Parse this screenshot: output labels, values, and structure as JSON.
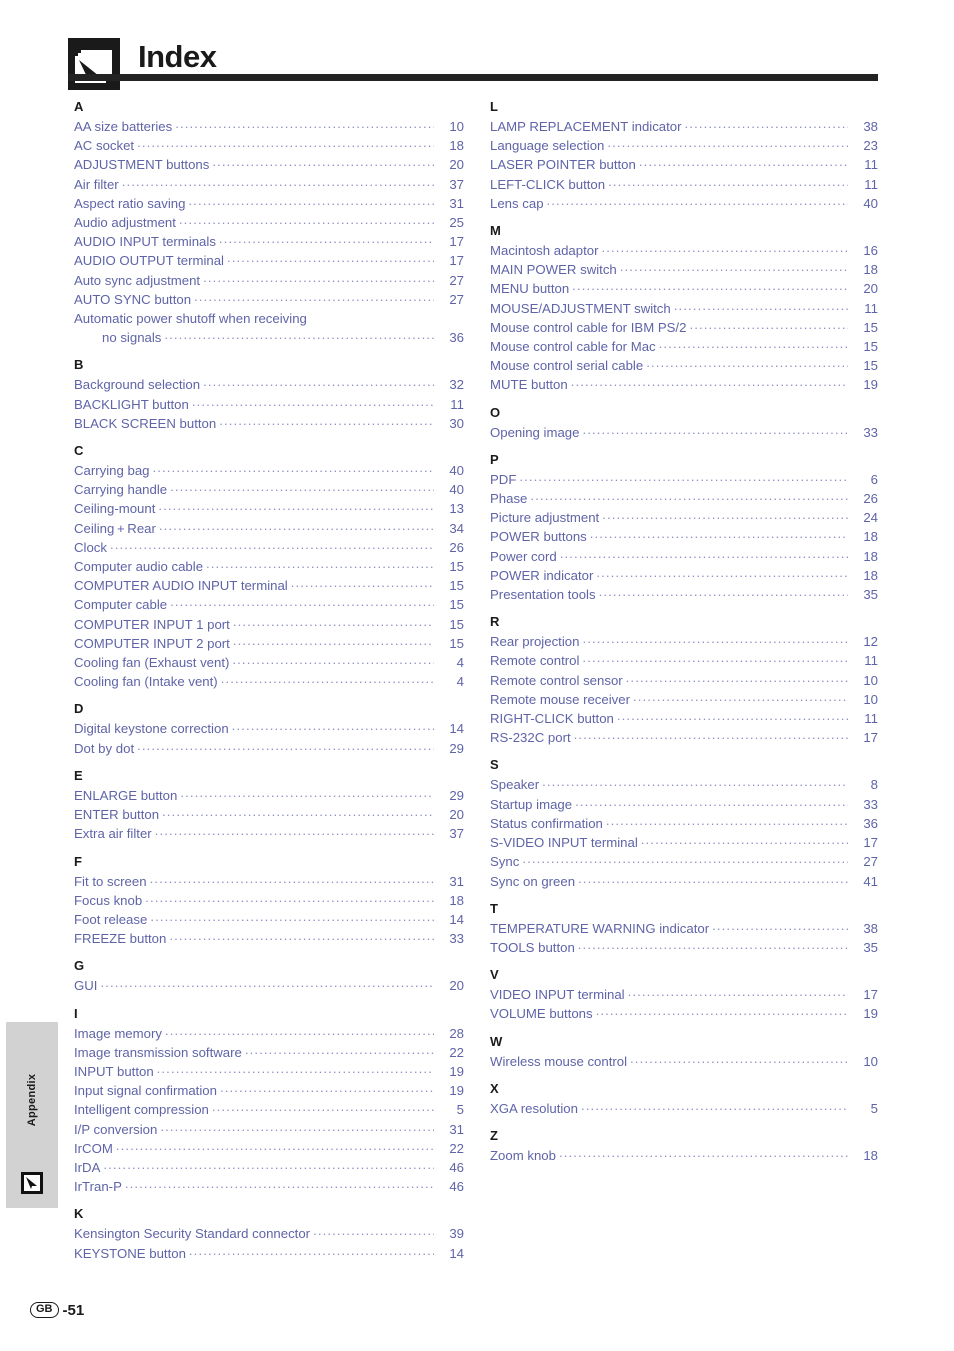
{
  "header": {
    "title": "Index",
    "icon": "index-cursor-pages-icon"
  },
  "sidebar_tab": {
    "label": "Appendix",
    "icon": "cursor-arrow-icon"
  },
  "footer": {
    "region_badge": "GB",
    "page_number": "-51"
  },
  "colors": {
    "entry_text": "#5f64a8",
    "heading_text": "#1a1a1a",
    "rule": "#232323",
    "tab_background": "#d2d2d2"
  },
  "columns": [
    {
      "groups": [
        {
          "letter": "A",
          "entries": [
            {
              "label": "AA size batteries",
              "page": "10"
            },
            {
              "label": "AC socket",
              "page": "18"
            },
            {
              "label": "ADJUSTMENT buttons",
              "page": "20"
            },
            {
              "label": "Air filter",
              "page": "37"
            },
            {
              "label": "Aspect ratio saving",
              "page": "31"
            },
            {
              "label": "Audio adjustment",
              "page": "25"
            },
            {
              "label": "AUDIO INPUT terminals",
              "page": "17"
            },
            {
              "label": "AUDIO OUTPUT terminal",
              "page": "17"
            },
            {
              "label": "Auto sync adjustment",
              "page": "27"
            },
            {
              "label": "AUTO SYNC button",
              "page": "27"
            },
            {
              "label": "Automatic power shutoff when receiving",
              "page": "",
              "dots": false
            },
            {
              "label": "no signals",
              "page": "36",
              "indent": true
            }
          ]
        },
        {
          "letter": "B",
          "entries": [
            {
              "label": "Background selection",
              "page": "32"
            },
            {
              "label": "BACKLIGHT button",
              "page": "11"
            },
            {
              "label": "BLACK SCREEN button",
              "page": "30"
            }
          ]
        },
        {
          "letter": "C",
          "entries": [
            {
              "label": "Carrying bag",
              "page": "40"
            },
            {
              "label": "Carrying handle",
              "page": "40"
            },
            {
              "label": "Ceiling-mount",
              "page": "13"
            },
            {
              "label": "Ceiling + Rear",
              "page": "34"
            },
            {
              "label": "Clock",
              "page": "26"
            },
            {
              "label": "Computer audio cable",
              "page": "15"
            },
            {
              "label": "COMPUTER AUDIO INPUT terminal",
              "page": "15"
            },
            {
              "label": "Computer cable",
              "page": "15"
            },
            {
              "label": "COMPUTER INPUT 1 port",
              "page": "15"
            },
            {
              "label": "COMPUTER INPUT 2 port",
              "page": "15"
            },
            {
              "label": "Cooling fan (Exhaust vent)",
              "page": "4"
            },
            {
              "label": "Cooling fan (Intake vent)",
              "page": "4"
            }
          ]
        },
        {
          "letter": "D",
          "entries": [
            {
              "label": "Digital keystone correction",
              "page": "14"
            },
            {
              "label": "Dot by dot",
              "page": "29"
            }
          ]
        },
        {
          "letter": "E",
          "entries": [
            {
              "label": "ENLARGE button",
              "page": "29"
            },
            {
              "label": "ENTER button",
              "page": "20"
            },
            {
              "label": "Extra air filter",
              "page": "37"
            }
          ]
        },
        {
          "letter": "F",
          "entries": [
            {
              "label": "Fit to screen",
              "page": "31"
            },
            {
              "label": "Focus knob",
              "page": "18"
            },
            {
              "label": "Foot release",
              "page": "14"
            },
            {
              "label": "FREEZE button",
              "page": "33"
            }
          ]
        },
        {
          "letter": "G",
          "entries": [
            {
              "label": "GUI",
              "page": "20"
            }
          ]
        },
        {
          "letter": "I",
          "entries": [
            {
              "label": "Image memory",
              "page": "28"
            },
            {
              "label": "Image transmission software",
              "page": "22"
            },
            {
              "label": "INPUT button",
              "page": "19"
            },
            {
              "label": "Input signal confirmation",
              "page": "19"
            },
            {
              "label": "Intelligent compression",
              "page": "5"
            },
            {
              "label": "I/P conversion",
              "page": "31"
            },
            {
              "label": "IrCOM",
              "page": "22"
            },
            {
              "label": "IrDA",
              "page": "46"
            },
            {
              "label": "IrTran-P",
              "page": "46"
            }
          ]
        },
        {
          "letter": "K",
          "entries": [
            {
              "label": "Kensington Security Standard connector",
              "page": "39"
            },
            {
              "label": "KEYSTONE button",
              "page": "14"
            }
          ]
        }
      ]
    },
    {
      "groups": [
        {
          "letter": "L",
          "entries": [
            {
              "label": "LAMP REPLACEMENT indicator",
              "page": "38"
            },
            {
              "label": "Language selection",
              "page": "23"
            },
            {
              "label": "LASER POINTER button",
              "page": "11"
            },
            {
              "label": "LEFT-CLICK button",
              "page": "11"
            },
            {
              "label": "Lens cap",
              "page": "40"
            }
          ]
        },
        {
          "letter": "M",
          "entries": [
            {
              "label": "Macintosh adaptor",
              "page": "16"
            },
            {
              "label": "MAIN POWER switch",
              "page": "18"
            },
            {
              "label": "MENU button",
              "page": "20"
            },
            {
              "label": "MOUSE/ADJUSTMENT switch",
              "page": "11"
            },
            {
              "label": "Mouse control cable for IBM PS/2",
              "page": "15"
            },
            {
              "label": "Mouse control cable for Mac",
              "page": "15"
            },
            {
              "label": "Mouse control serial cable",
              "page": "15"
            },
            {
              "label": "MUTE button",
              "page": "19"
            }
          ]
        },
        {
          "letter": "O",
          "entries": [
            {
              "label": "Opening image",
              "page": "33"
            }
          ]
        },
        {
          "letter": "P",
          "entries": [
            {
              "label": "PDF",
              "page": "6"
            },
            {
              "label": "Phase",
              "page": "26"
            },
            {
              "label": "Picture adjustment",
              "page": "24"
            },
            {
              "label": "POWER buttons",
              "page": "18"
            },
            {
              "label": "Power cord",
              "page": "18"
            },
            {
              "label": "POWER indicator",
              "page": "18"
            },
            {
              "label": "Presentation tools",
              "page": "35"
            }
          ]
        },
        {
          "letter": "R",
          "entries": [
            {
              "label": "Rear projection",
              "page": "12"
            },
            {
              "label": "Remote control",
              "page": "11"
            },
            {
              "label": "Remote control sensor",
              "page": "10"
            },
            {
              "label": "Remote mouse receiver",
              "page": "10"
            },
            {
              "label": "RIGHT-CLICK button",
              "page": "11"
            },
            {
              "label": "RS-232C port",
              "page": "17"
            }
          ]
        },
        {
          "letter": "S",
          "entries": [
            {
              "label": "Speaker",
              "page": "8"
            },
            {
              "label": "Startup image",
              "page": "33"
            },
            {
              "label": "Status confirmation",
              "page": "36"
            },
            {
              "label": "S-VIDEO INPUT terminal",
              "page": "17"
            },
            {
              "label": "Sync",
              "page": "27"
            },
            {
              "label": "Sync on green",
              "page": "41"
            }
          ]
        },
        {
          "letter": "T",
          "entries": [
            {
              "label": "TEMPERATURE WARNING indicator",
              "page": "38"
            },
            {
              "label": "TOOLS button",
              "page": "35"
            }
          ]
        },
        {
          "letter": "V",
          "entries": [
            {
              "label": "VIDEO INPUT terminal",
              "page": "17"
            },
            {
              "label": "VOLUME buttons",
              "page": "19"
            }
          ]
        },
        {
          "letter": "W",
          "entries": [
            {
              "label": "Wireless mouse control",
              "page": "10"
            }
          ]
        },
        {
          "letter": "X",
          "entries": [
            {
              "label": "XGA resolution",
              "page": "5"
            }
          ]
        },
        {
          "letter": "Z",
          "entries": [
            {
              "label": "Zoom knob",
              "page": "18"
            }
          ]
        }
      ]
    }
  ]
}
